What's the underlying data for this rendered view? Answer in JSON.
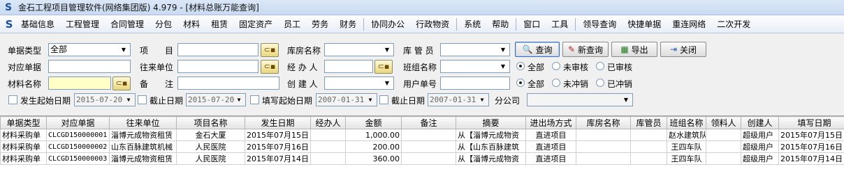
{
  "window": {
    "title": "金石工程项目管理软件(网络集团版) 4.979 - [材料总账万能查询]"
  },
  "menu": [
    "基础信息",
    "工程管理",
    "合同管理",
    "分包",
    "材料",
    "租赁",
    "固定资产",
    "员工",
    "劳务",
    "财务",
    "协同办公",
    "行政物资",
    "系统",
    "帮助",
    "窗口",
    "工具",
    "领导查询",
    "快捷单据",
    "重连网络",
    "二次开发"
  ],
  "filters": {
    "doc_type_label": "单据类型",
    "doc_type_value": "全部",
    "item_label": "项　　目",
    "warehouse_label": "库房名称",
    "keeper_label": "库 管 员",
    "ref_doc_label": "对应单据",
    "partner_label": "往来单位",
    "handler_label": "经 办 人",
    "team_label": "班组名称",
    "material_label": "材料名称",
    "remark_label": "备　　注",
    "creator_label": "创 建 人",
    "user_docno_label": "用户单号",
    "start_date_label": "发生起始日期",
    "start_date_value": "2015-07-20",
    "end_date_label": "截止日期",
    "end_date_value": "2015-07-20",
    "fill_start_label": "填写起始日期",
    "fill_start_value": "2007-01-31",
    "fill_end_label": "截止日期",
    "fill_end_value": "2007-01-31",
    "branch_label": "分公司"
  },
  "audit_radios": {
    "all": "全部",
    "unaudited": "未审核",
    "audited": "已审核"
  },
  "offset_radios": {
    "all": "全部",
    "unoffset": "未冲销",
    "offset": "已冲销"
  },
  "buttons": {
    "query": "查询",
    "new_query": "新查询",
    "export": "导出",
    "close": "关闭"
  },
  "table": {
    "headers": [
      "单据类型",
      "对应单据",
      "往来单位",
      "项目名称",
      "发生日期",
      "经办人",
      "金额",
      "备注",
      "摘要",
      "进出场方式",
      "库房名称",
      "库管员",
      "班组名称",
      "领料人",
      "创建人",
      "填写日期"
    ],
    "rows": [
      [
        "材料采购单",
        "CLCGD150000001",
        "淄博元成物资租赁",
        "金石大厦",
        "2015年07月15日",
        "",
        "1,000.00",
        "",
        "从【淄博元成物资",
        "直进项目",
        "",
        "",
        "赵水建筑队",
        "",
        "超级用户",
        "2015年07月15日"
      ],
      [
        "材料采购单",
        "CLCGD150000002",
        "山东百脉建筑机械",
        "人民医院",
        "2015年07月16日",
        "",
        "200.00",
        "",
        "从【山东百脉建筑",
        "直进项目",
        "",
        "",
        "王四车队",
        "",
        "超级用户",
        "2015年07月16日"
      ],
      [
        "材料采购单",
        "CLCGD150000003",
        "淄博元成物资租赁",
        "人民医院",
        "2015年07月14日",
        "",
        "360.00",
        "",
        "从【淄博元成物资",
        "直进项目",
        "",
        "",
        "王四车队",
        "",
        "超级用户",
        "2015年07月14日"
      ]
    ]
  }
}
